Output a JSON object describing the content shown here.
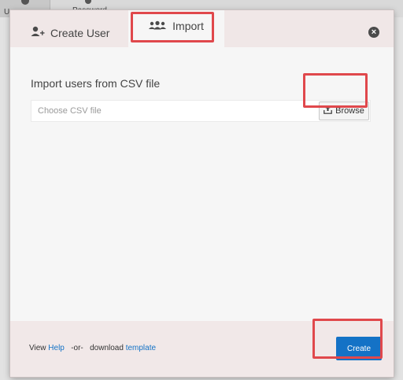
{
  "background": {
    "tabs": [
      {
        "label": "User"
      },
      {
        "label": "Password"
      }
    ]
  },
  "dialog": {
    "tabs": {
      "create_user": {
        "label": "Create User",
        "icon": "add-user-icon"
      },
      "import": {
        "label": "Import",
        "icon": "group-icon",
        "active": true
      }
    },
    "close_icon": "close-icon",
    "section_title": "Import users from CSV file",
    "file_input": {
      "placeholder": "Choose CSV file",
      "value": ""
    },
    "browse_button": {
      "label": "Browse",
      "icon": "upload-icon"
    },
    "footer": {
      "view": "View",
      "help_link": "Help",
      "or": "-or-",
      "download": "download",
      "template_link": "template"
    },
    "create_button": {
      "label": "Create"
    }
  },
  "colors": {
    "accent": "#1472c6",
    "highlight": "#e0484c",
    "link": "#1573c6"
  }
}
